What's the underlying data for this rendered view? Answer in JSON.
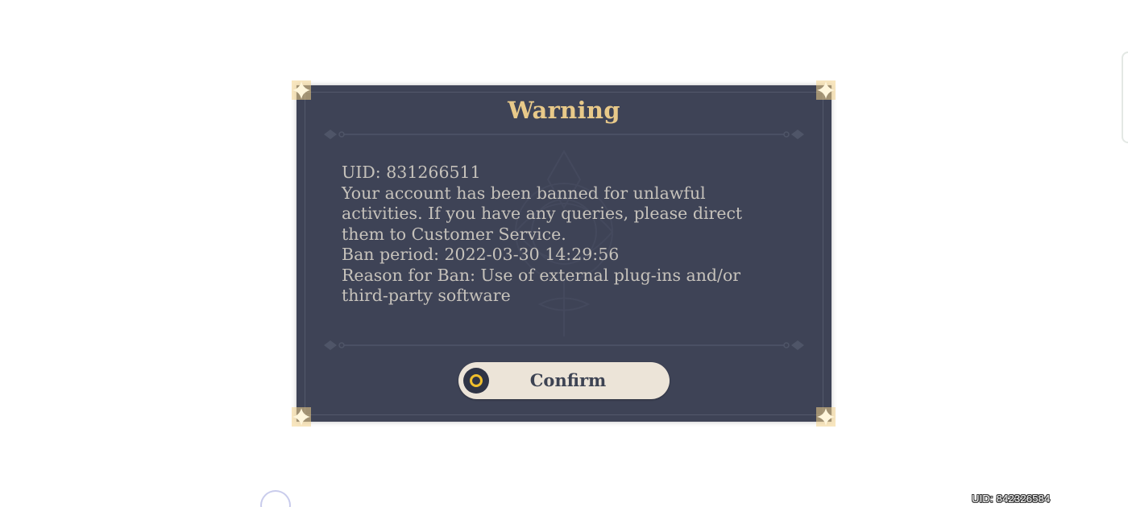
{
  "dialog": {
    "title": "Warning",
    "message_lines": [
      "UID: 831266511",
      "Your account has been banned for unlawful",
      "activities. If you have any queries, please direct",
      "them to Customer Service.",
      "Ban period: 2022-03-30 14:29:56",
      "Reason for Ban: Use of external plug-ins and/or",
      "third-party software"
    ],
    "confirm_label": "Confirm",
    "confirm_icon": "circle-confirm-icon"
  },
  "footer": {
    "uid_label": "UID: 842326584",
    "loading_icon": "loading-spinner-icon"
  },
  "colors": {
    "dialog_background": "#3e4356",
    "title": "#e8c989",
    "message_text": "#c6c2bb",
    "button_background": "#ece4d8",
    "button_text": "#3d4353",
    "accent_gold": "#f0bf2c"
  }
}
